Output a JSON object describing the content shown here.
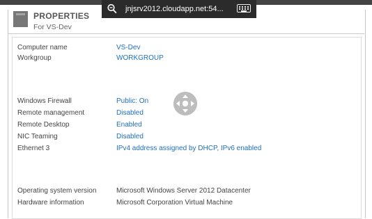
{
  "header": {
    "title": "PROPERTIES",
    "subtitle": "For VS-Dev"
  },
  "remote_toolbar": {
    "host": "jnjsrv2012.cloudapp.net:54..."
  },
  "properties": [
    {
      "label": "Computer name",
      "value": "VS-Dev",
      "link": true
    },
    {
      "label": "Workgroup",
      "value": "WORKGROUP",
      "link": true
    },
    {
      "label": "Windows Firewall",
      "value": "Public: On",
      "link": true
    },
    {
      "label": "Remote management",
      "value": "Disabled",
      "link": true
    },
    {
      "label": "Remote Desktop",
      "value": "Enabled",
      "link": true
    },
    {
      "label": "NIC Teaming",
      "value": "Disabled",
      "link": true
    },
    {
      "label": "Ethernet 3",
      "value": "IPv4 address assigned by DHCP, IPv6 enabled",
      "link": true
    },
    {
      "label": "Operating system version",
      "value": "Microsoft Windows Server 2012 Datacenter",
      "link": false
    },
    {
      "label": "Hardware information",
      "value": "Microsoft Corporation Virtual Machine",
      "link": false
    }
  ],
  "colors": {
    "link": "#1e6fc1",
    "toolbar": "#2b2b2b"
  }
}
